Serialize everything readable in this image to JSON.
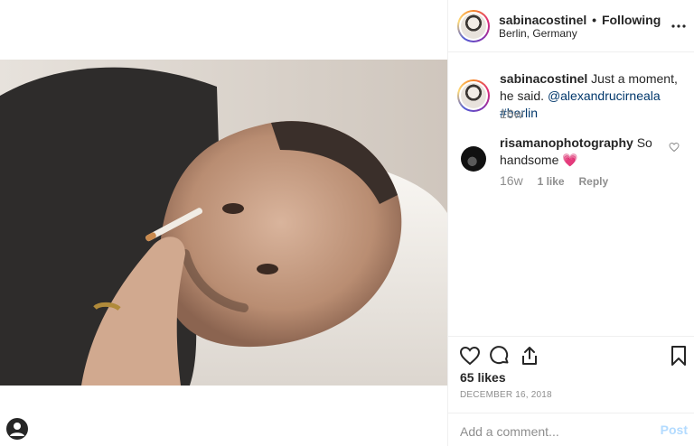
{
  "post": {
    "author": "sabinacostinel",
    "separator": "•",
    "follow_status": "Following",
    "location": "Berlin, Germany"
  },
  "caption": {
    "username": "sabinacostinel",
    "text": "Just a moment, he said.",
    "mention": "@alexandrucirneala",
    "hashtag": "#berlin",
    "age": "16w"
  },
  "comments": [
    {
      "username": "risamanophotography",
      "text": "So handsome",
      "emoji": "💗",
      "age": "16w",
      "likes": "1 like",
      "reply_label": "Reply"
    }
  ],
  "engagement": {
    "likes": "65 likes",
    "date": "DECEMBER 16, 2018"
  },
  "composer": {
    "placeholder": "Add a comment...",
    "post_label": "Post"
  },
  "icons": {
    "more": "more-options-icon",
    "like": "heart-icon",
    "comment": "comment-icon",
    "share": "share-icon",
    "save": "bookmark-icon",
    "profile": "profile-icon"
  },
  "colors": {
    "link": "#00376b",
    "muted": "#8e8e8e",
    "post_button_disabled": "#b3dbff",
    "border": "#efefef"
  }
}
